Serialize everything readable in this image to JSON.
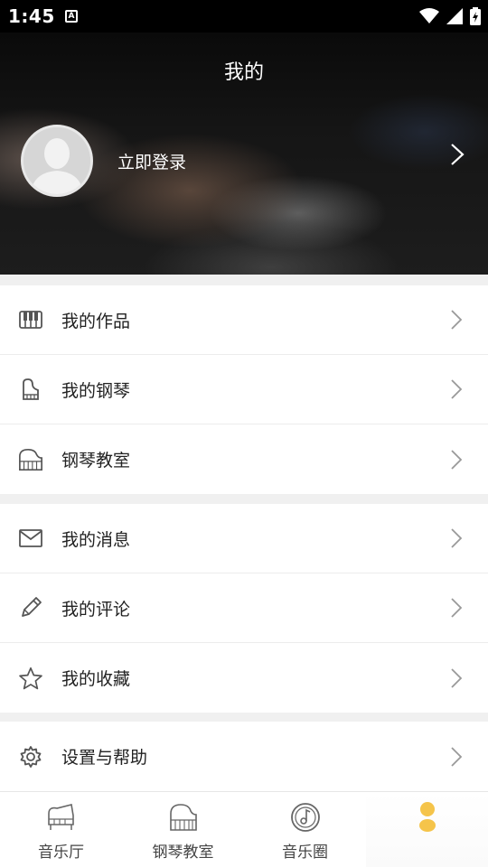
{
  "status_bar": {
    "time": "1:45",
    "notification_glyph": "A"
  },
  "header": {
    "title": "我的",
    "login_label": "立即登录"
  },
  "menu_groups": [
    {
      "items": [
        {
          "label": "我的作品",
          "icon": "piano-keys-icon"
        },
        {
          "label": "我的钢琴",
          "icon": "upright-piano-icon"
        },
        {
          "label": "钢琴教室",
          "icon": "grand-piano-icon"
        }
      ]
    },
    {
      "items": [
        {
          "label": "我的消息",
          "icon": "mail-icon"
        },
        {
          "label": "我的评论",
          "icon": "pencil-icon"
        },
        {
          "label": "我的收藏",
          "icon": "star-icon"
        }
      ]
    },
    {
      "items": [
        {
          "label": "设置与帮助",
          "icon": "gear-icon"
        }
      ]
    }
  ],
  "bottom_nav": {
    "tabs": [
      {
        "label": "音乐厅",
        "icon": "grand-piano-icon"
      },
      {
        "label": "钢琴教室",
        "icon": "piano-classroom-icon"
      },
      {
        "label": "音乐圈",
        "icon": "music-disc-icon"
      },
      {
        "label": "",
        "icon": "profile-active-icon"
      }
    ],
    "active_index": 3
  },
  "colors": {
    "accent": "#f5c44a",
    "status_bg": "#000000",
    "divider": "#f0f0f0",
    "icon_gray": "#555555"
  }
}
